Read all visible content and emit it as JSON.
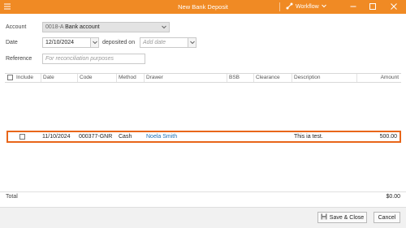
{
  "window": {
    "title": "New Bank Deposit",
    "workflow_label": "Workflow",
    "accent": "#f08a24"
  },
  "form": {
    "account_label": "Account",
    "account_code": "0018-A",
    "account_name": "Bank account",
    "date_label": "Date",
    "date_value": "12/10/2024",
    "deposited_on_label": "deposited on",
    "deposited_on_placeholder": "Add date",
    "reference_label": "Reference",
    "reference_placeholder": "For reconciliation purposes"
  },
  "grid": {
    "columns": [
      "Include",
      "Date",
      "Code",
      "Method",
      "Drawer",
      "BSB",
      "Clearance",
      "Description",
      "Amount"
    ],
    "rows": [
      {
        "date": "11/10/2024",
        "code": "000377-GNR",
        "method": "Cash",
        "drawer": "Noela Smith",
        "description": "This ia test.",
        "amount": "500.00"
      }
    ],
    "highlight_color": "#e8661a"
  },
  "totals": {
    "label": "Total",
    "value": "$0.00"
  },
  "footer": {
    "save_close_label": "Save & Close",
    "cancel_label": "Cancel"
  }
}
